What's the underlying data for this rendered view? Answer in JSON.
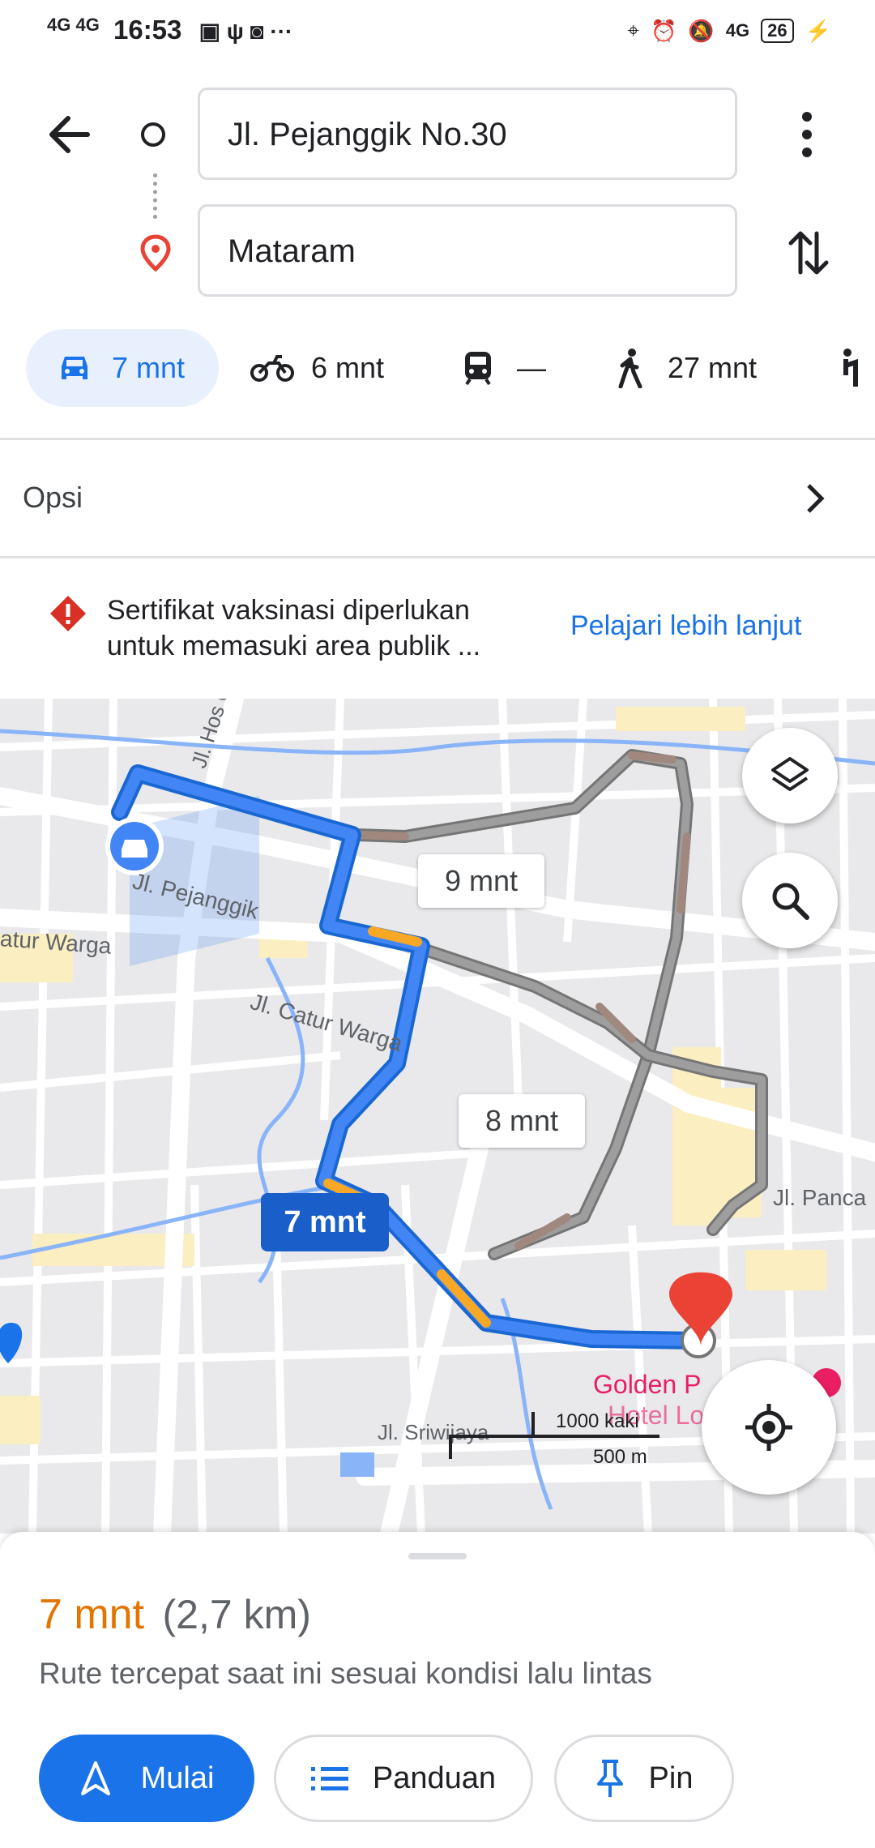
{
  "status_bar": {
    "time": "16:53",
    "network_left": "4G 4G",
    "battery": "26"
  },
  "route": {
    "origin": "Jl. Pejanggik No.30",
    "destination": "Mataram"
  },
  "modes": [
    {
      "icon": "car-icon",
      "label": "7 mnt"
    },
    {
      "icon": "motorcycle-icon",
      "label": "6 mnt"
    },
    {
      "icon": "transit-icon",
      "label": "—"
    },
    {
      "icon": "walk-icon",
      "label": "27 mnt"
    }
  ],
  "options": {
    "label": "Opsi"
  },
  "alert": {
    "text_line1": "Sertifikat vaksinasi diperlukan",
    "text_line2": "untuk memasuki area publik ...",
    "link": "Pelajari lebih lanjut"
  },
  "map": {
    "street_labels": [
      "Jl. Hos Cokroa",
      "Jl. Pejanggik",
      "atur Warga",
      "Jl. Catur Warga",
      "Jl. Panca",
      "Jl. Sriwijaya"
    ],
    "poi": [
      "Golden P",
      "Hotel Lo"
    ],
    "route_labels": {
      "main": "7 mnt",
      "alt1": "9 mnt",
      "alt2": "8 mnt"
    },
    "scale": {
      "top": "1000 kaki",
      "bottom": "500 m"
    },
    "colors": {
      "route": "#4285f4",
      "route_border": "#1967d2",
      "traffic": "#f9a825",
      "alt_route": "#9e9e9e",
      "pin": "#ea4335"
    }
  },
  "summary": {
    "duration": "7 mnt",
    "distance": "(2,7 km)",
    "note": "Rute tercepat saat ini sesuai kondisi lalu lintas",
    "accent": "#e37400"
  },
  "actions": {
    "start": "Mulai",
    "steps": "Panduan",
    "pin": "Pin"
  }
}
